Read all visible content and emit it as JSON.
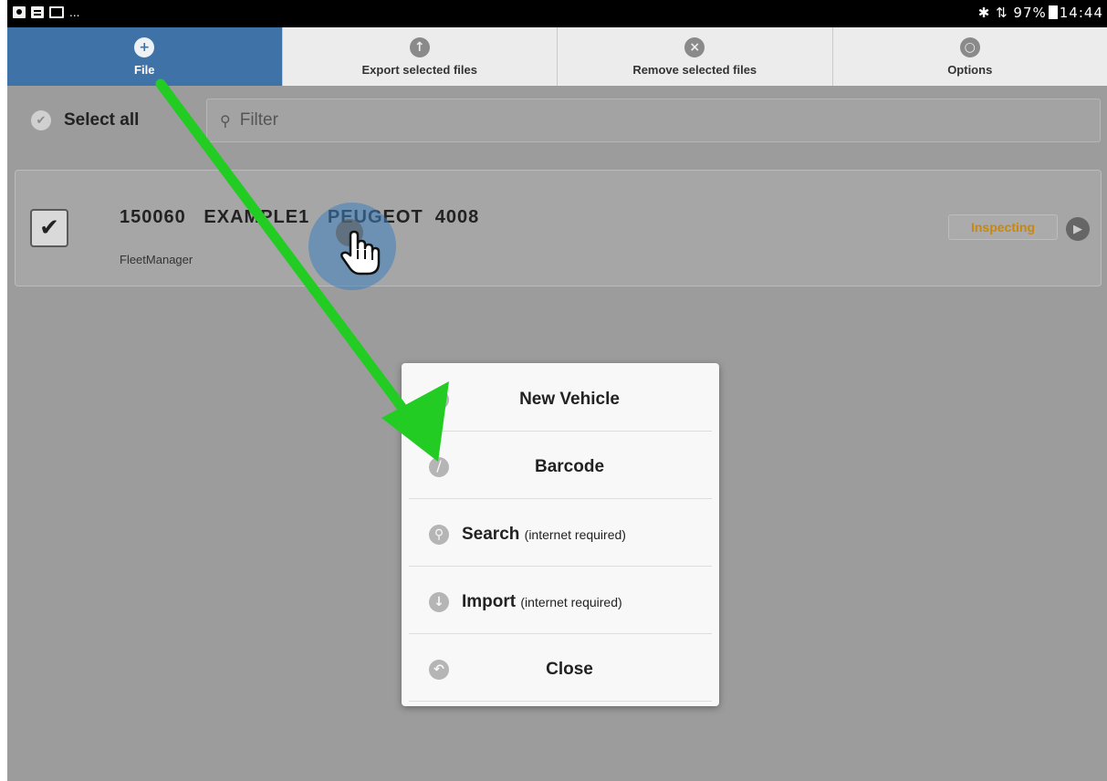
{
  "status_bar": {
    "left_icons": [
      "image-icon",
      "document-icon",
      "mail-icon"
    ],
    "overflow": "...",
    "bluetooth": "✱",
    "signal": "⇅",
    "battery": "97%",
    "time": "14:44"
  },
  "toolbar": {
    "items": [
      {
        "label": "File",
        "icon": "plus-icon",
        "glyph": "+"
      },
      {
        "label": "Export selected files",
        "icon": "arrow-up-icon",
        "glyph": "↑"
      },
      {
        "label": "Remove selected files",
        "icon": "close-icon",
        "glyph": "×"
      },
      {
        "label": "Options",
        "icon": "settings-icon",
        "glyph": "○"
      }
    ],
    "active_color": "#3f73a7"
  },
  "filter": {
    "select_all_label": "Select all",
    "placeholder": "Filter"
  },
  "vehicle": {
    "title": "150060   EXAMPLE1   PEUGEOT  4008",
    "owner": "FleetManager",
    "status": "Inspecting",
    "status_color": "#c9870e",
    "checked": true
  },
  "popup": {
    "items": [
      {
        "label": "New Vehicle",
        "sub": "",
        "icon": "plus-icon",
        "glyph": "+"
      },
      {
        "label": "Barcode",
        "sub": "",
        "icon": "barcode-icon",
        "glyph": "⧸"
      },
      {
        "label": "Search",
        "sub": "(internet required)",
        "icon": "search-icon",
        "glyph": "⚲"
      },
      {
        "label": "Import",
        "sub": "(internet required)",
        "icon": "download-icon",
        "glyph": "↓"
      },
      {
        "label": "Close",
        "sub": "",
        "icon": "back-icon",
        "glyph": "↶"
      }
    ]
  },
  "annotation": {
    "arrow_color": "#22cc22"
  }
}
